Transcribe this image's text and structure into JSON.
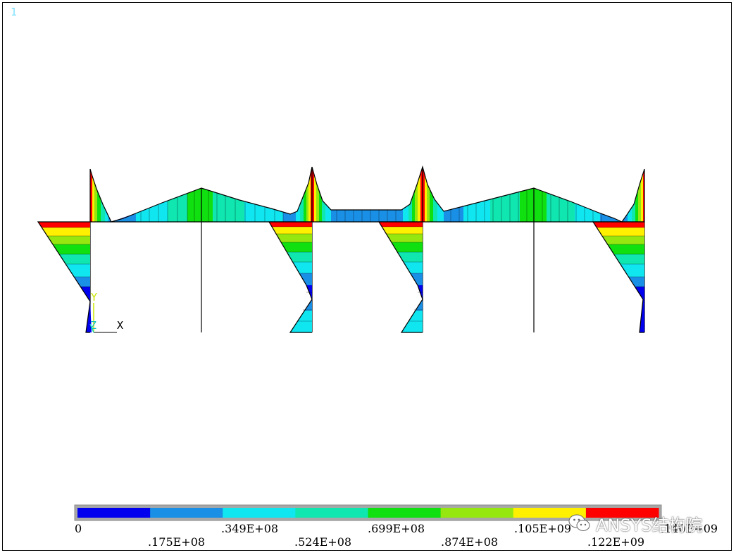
{
  "window": {
    "number": "1"
  },
  "triad": {
    "x": "X",
    "y": "Y",
    "z": "Z"
  },
  "legend": {
    "colors": [
      "#0000ee",
      "#1a8fe6",
      "#10e6f0",
      "#10e6b0",
      "#10e010",
      "#96e610",
      "#fff000",
      "#ff0000"
    ],
    "labels": [
      ".175E+08",
      ".349E+08",
      ".524E+08",
      ".699E+08",
      ".874E+08",
      ".105E+09",
      ".122E+09",
      ".140E+09"
    ],
    "label_top": [
      "0",
      ".349E+08",
      ".699E+08",
      ".105E+09",
      ".140E+09"
    ],
    "label_bottom": [
      ".175E+08",
      ".524E+08",
      ".874E+08",
      ".122E+09"
    ]
  },
  "watermark": {
    "text": "ANSYS结构院",
    "icon": "wechat-icon"
  }
}
